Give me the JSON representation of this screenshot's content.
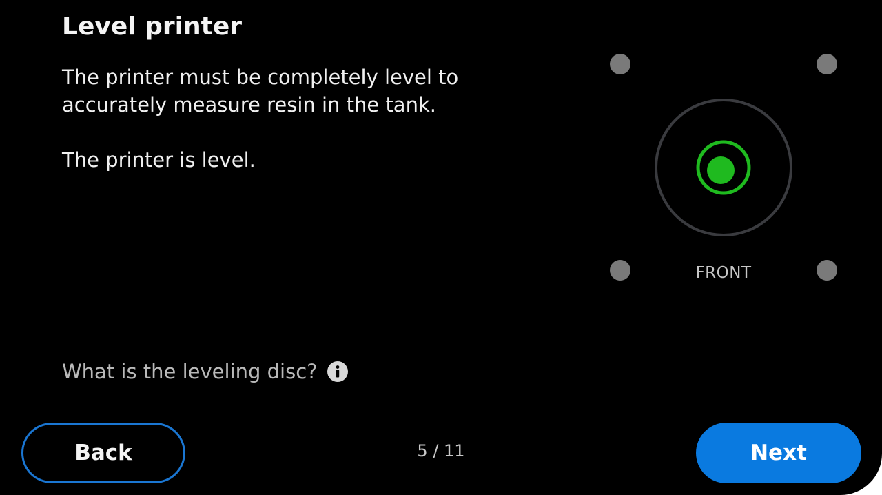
{
  "header": {
    "title": "Level printer"
  },
  "main": {
    "description": "The printer must be completely level to accurately measure resin in the tank.",
    "status": "The printer is level.",
    "help_link": "What is the leveling disc?",
    "diagram": {
      "front_label": "FRONT",
      "level_state": "level",
      "indicator_color": "#1fba1f",
      "ring_color": "#3a3b3f",
      "corner_dot_color": "#7a7a7a"
    }
  },
  "footer": {
    "back_label": "Back",
    "next_label": "Next",
    "page_indicator": "5 / 11",
    "current_step": 5,
    "total_steps": 11
  },
  "colors": {
    "accent": "#0a7ae0",
    "background": "#000000"
  }
}
